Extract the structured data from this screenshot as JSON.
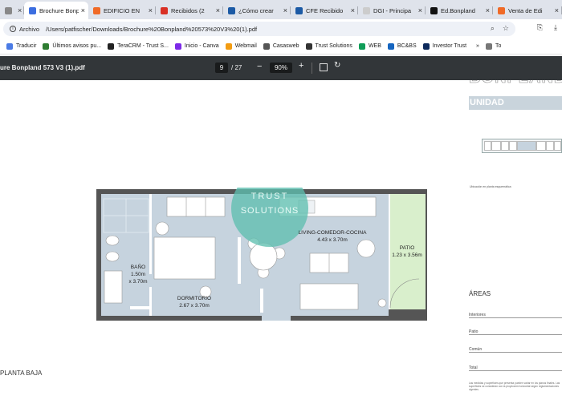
{
  "browser": {
    "tabs": [
      {
        "label": "A",
        "icon": "page-icon",
        "active": false
      },
      {
        "label": "Brochure Bonpla",
        "icon": "pdf-icon",
        "active": true
      },
      {
        "label": "EDIFICIO EN",
        "icon": "orange-icon",
        "active": false
      },
      {
        "label": "Recibidos (2",
        "icon": "gmail-icon",
        "active": false
      },
      {
        "label": "¿Cómo crear",
        "icon": "m-icon",
        "active": false
      },
      {
        "label": "CFE Recibido",
        "icon": "m-icon",
        "active": false
      },
      {
        "label": "DGI - Principa",
        "icon": "dgi-icon",
        "active": false
      },
      {
        "label": "Ed.Bonpland",
        "icon": "doc-icon",
        "active": false
      },
      {
        "label": "Venta de Edi",
        "icon": "orange-icon",
        "active": false
      }
    ],
    "address": {
      "scheme_label": "Archivo",
      "url": "/Users/patfischer/Downloads/Brochure%20Bonpland%20573%20V3%20(1).pdf"
    },
    "bookmarks": [
      {
        "label": "Traducir",
        "color": "#4a7be5"
      },
      {
        "label": "Últimos avisos pu...",
        "color": "#2e7d32"
      },
      {
        "label": "TeraCRM - Trust S...",
        "color": "#222222"
      },
      {
        "label": "Inicio - Canva",
        "color": "#7d2ae8"
      },
      {
        "label": "Webmail",
        "color": "#f39c12"
      },
      {
        "label": "Casasweb",
        "color": "#555555"
      },
      {
        "label": "Trust Solutions",
        "color": "#333333"
      },
      {
        "label": "WEB",
        "color": "#0f9d58"
      },
      {
        "label": "BC&BS",
        "color": "#1565c0"
      },
      {
        "label": "Investor Trust",
        "color": "#0d2a5c"
      },
      {
        "label": "To",
        "color": "#777777"
      }
    ],
    "bookmarks_more": "»"
  },
  "pdf": {
    "title": "ure Bonpland 573 V3 (1).pdf",
    "page_current": "9",
    "page_total": "/ 27",
    "zoom": "90%"
  },
  "doc": {
    "heading": "BONPLAND",
    "unit_label": "UNIDAD",
    "location_caption": "Ubicación en planta esquemática",
    "areas_heading": "ÁREAS",
    "area_rows": [
      "Interiores",
      "Patio",
      "Común",
      "Total"
    ],
    "footnote": "Las medidas y superficies que presenta pueden variar en los planos finales. Las superficies se consideran con la proyección horizontal según reglamentaciones vigentes.",
    "floor_label": "PLANTA BAJA",
    "watermark_line1": "TRUST",
    "watermark_line2": "SOLUTIONS"
  },
  "rooms": {
    "bano_name": "BAÑO",
    "bano_dim1": "1.50m",
    "bano_dim2": "x 3.70m",
    "dorm_name": "DORMITORIO",
    "dorm_dim": "2.67 x 3.70m",
    "living_name": "LIVING-COMEDOR-COCINA",
    "living_dim": "4.43 x 3.70m",
    "patio_name": "PATIO",
    "patio_dim": "1.23 x 3.56m"
  },
  "colors": {
    "floor": "#c6d3de",
    "patio": "#d9efcc",
    "watermark": "#5fbfb0"
  }
}
